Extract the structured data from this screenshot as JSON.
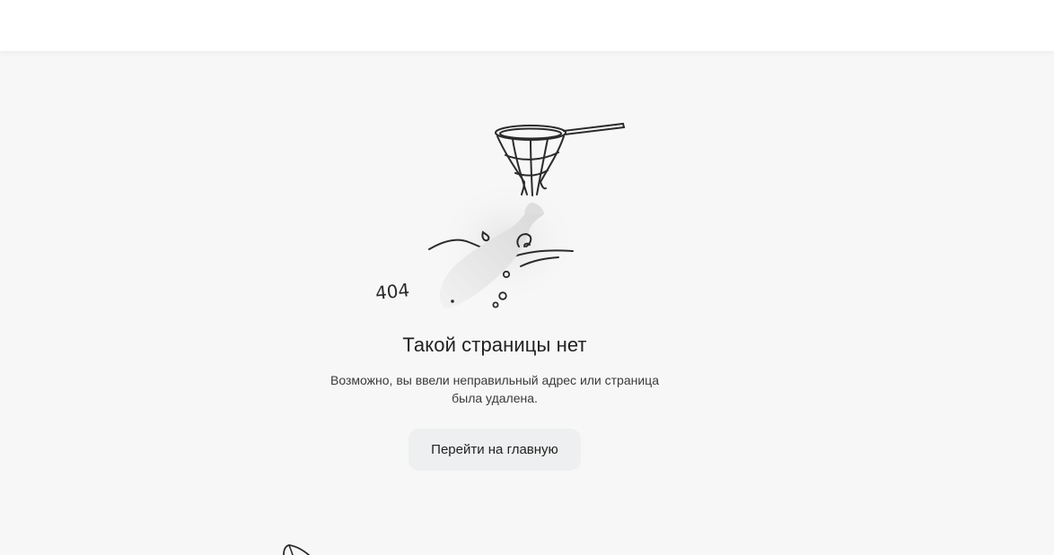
{
  "error": {
    "code_label": "404",
    "title": "Такой страницы нет",
    "subtitle_line1": "Возможно, вы ввели неправильный адрес или страница",
    "subtitle_line2": "была удалена."
  },
  "actions": {
    "home_button_label": "Перейти на главную"
  },
  "icons": {
    "illustration": "fish-escaping-net-illustration",
    "net": "landing-net-icon",
    "fish": "fish-icon",
    "footer": "fish-fin-icon"
  },
  "colors": {
    "page_background": "#f7f7f7",
    "header_background": "#ffffff",
    "button_background": "#eeeff0",
    "text": "#222222",
    "line_art": "#2b2b2b"
  }
}
